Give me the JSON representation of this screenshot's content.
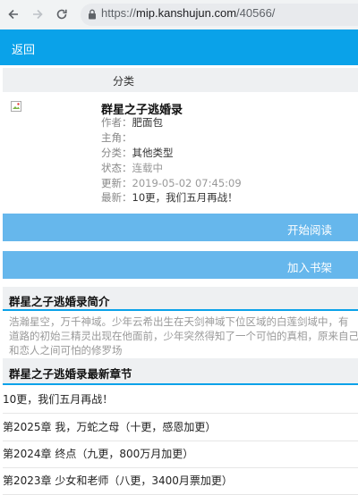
{
  "browser": {
    "url_scheme": "https://",
    "url_host": "mip.kanshujun.com",
    "url_path": "/40566/"
  },
  "header": {
    "back_label": "返回"
  },
  "category_label": "分类",
  "book": {
    "title": "群星之子逃婚录",
    "fields": [
      {
        "key": "作者：",
        "value": "肥面包",
        "muted": false
      },
      {
        "key": "主角：",
        "value": "",
        "muted": false
      },
      {
        "key": "分类：",
        "value": "其他类型",
        "muted": false
      },
      {
        "key": "状态：",
        "value": "连载中",
        "muted": true
      },
      {
        "key": "更新：",
        "value": "2019-05-02 07:45:09",
        "muted": true
      },
      {
        "key": "最新：",
        "value": "10更，我们五月再战！",
        "muted": false
      }
    ]
  },
  "buttons": {
    "start_reading": "开始阅读",
    "add_bookshelf": "加入书架"
  },
  "intro": {
    "heading": "群星之子逃婚录简介",
    "lines": [
      "浩瀚星空，万千神域。少年云希出生在天剑神域下位区域的白莲剑域中，有",
      "道路的初始三精灵出现在他面前，少年突然得知了一个可怕的真相，原来自己",
      "和恋人之间可怕的修罗场"
    ]
  },
  "chapters": {
    "heading": "群星之子逃婚录最新章节",
    "items": [
      "10更，我们五月再战！",
      "第2025章 我，万蛇之母（十更，感恩加更）",
      "第2024章 终点（九更，800万月加更）",
      "第2023章 少女和老师（八更，3400月票加更）"
    ]
  }
}
